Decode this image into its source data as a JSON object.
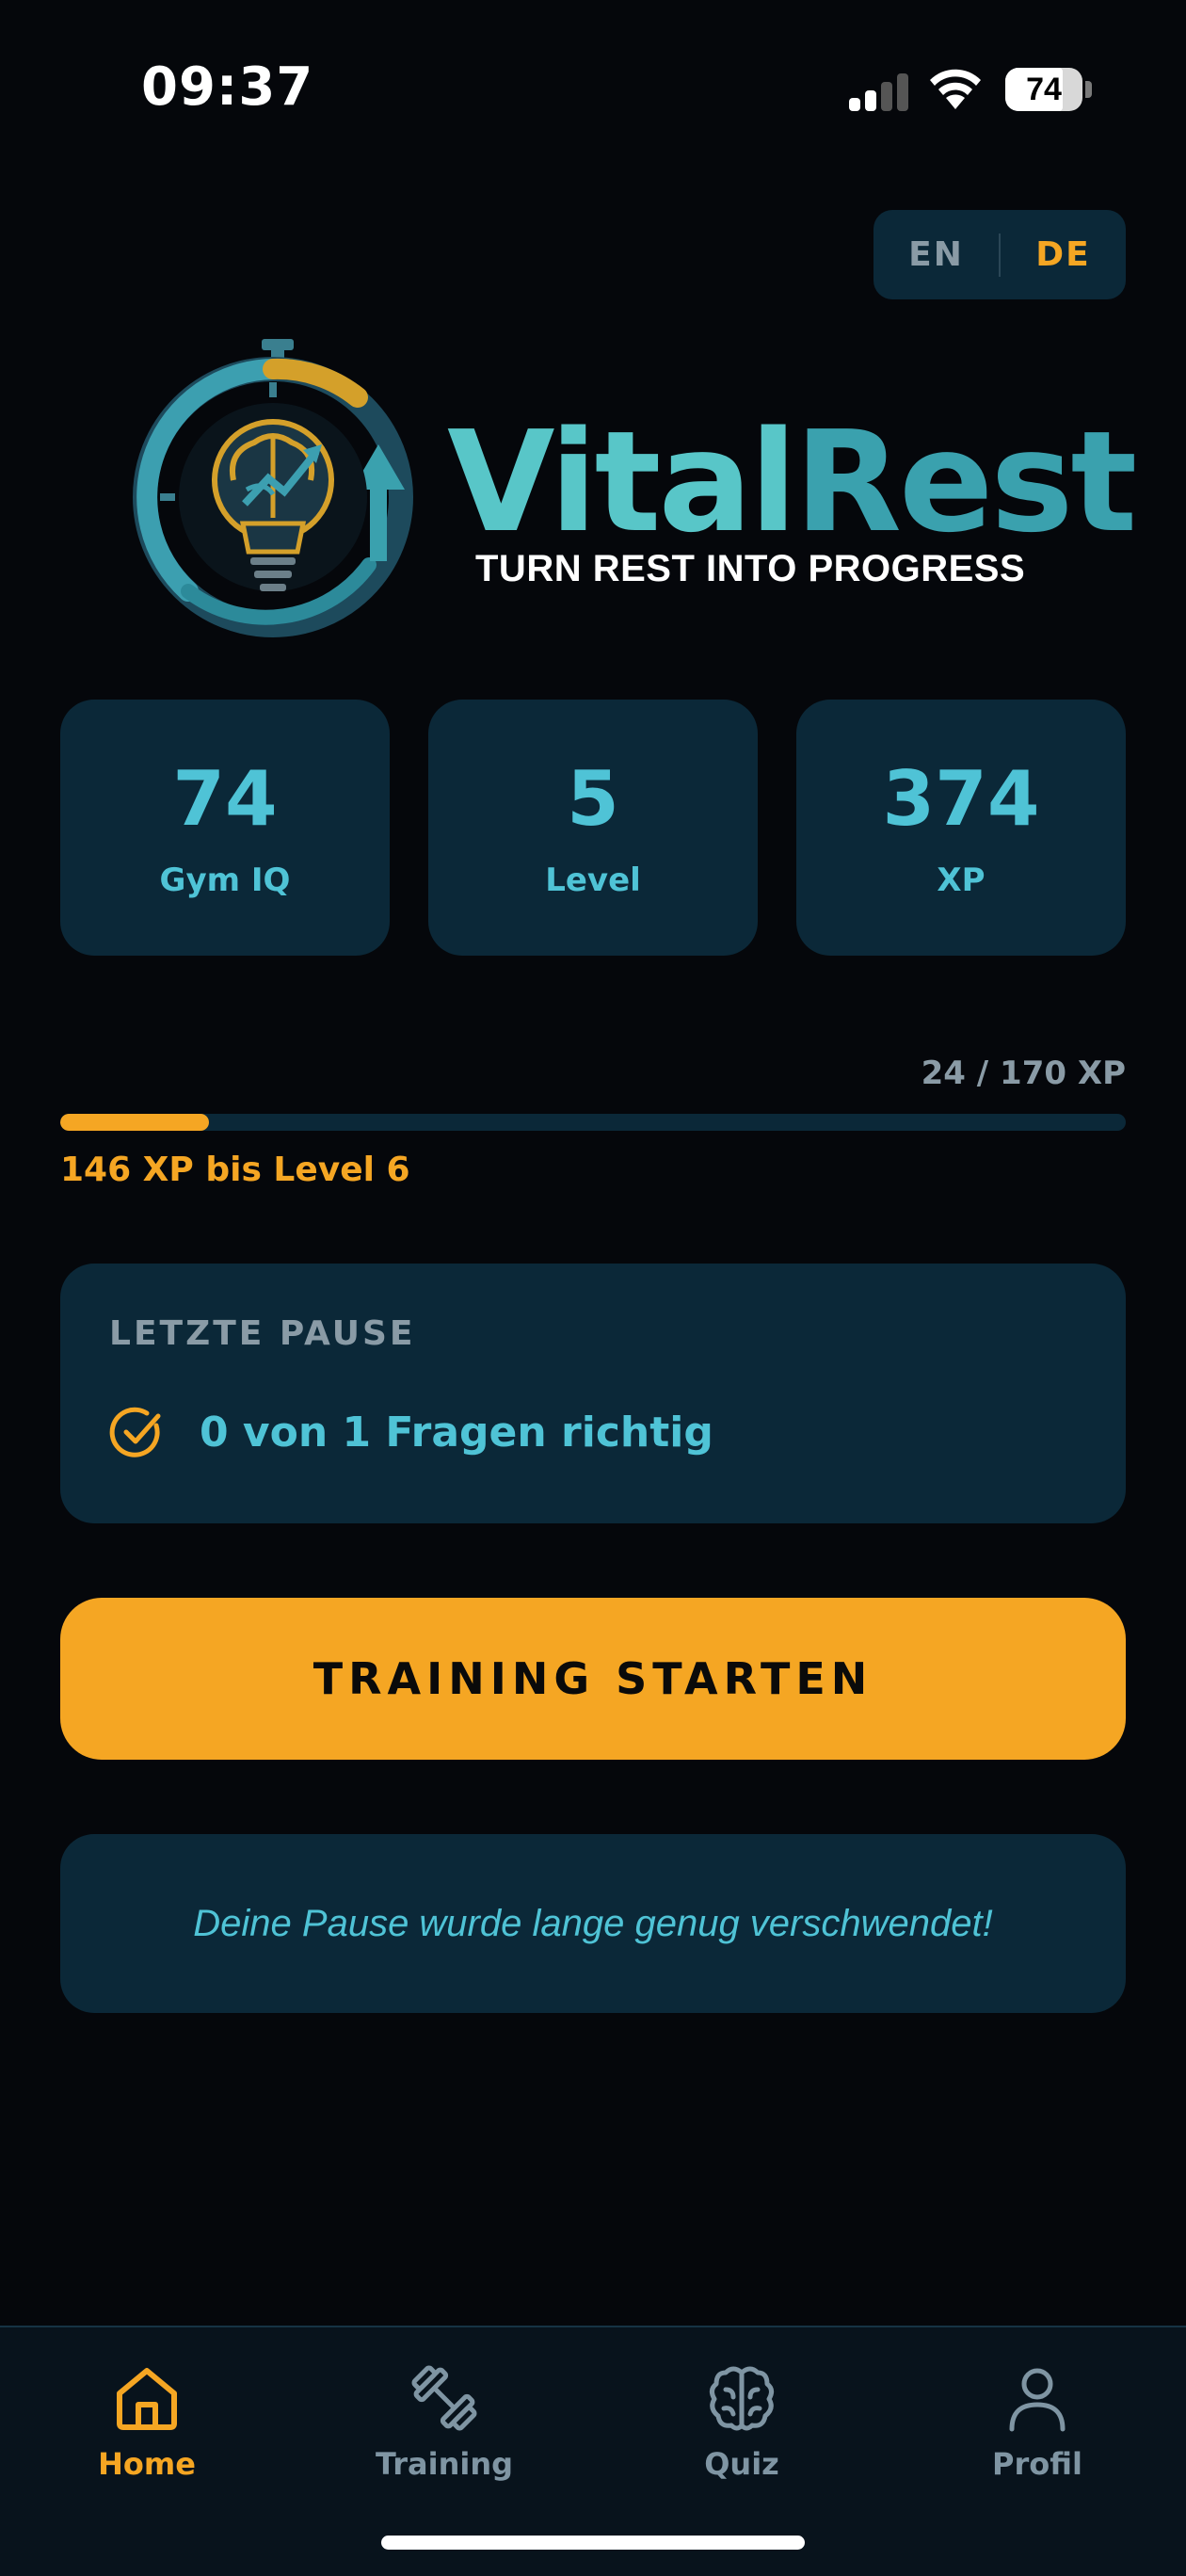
{
  "status_bar": {
    "time": "09:37",
    "battery_level": "74",
    "battery_fraction": 0.74
  },
  "language": {
    "options": [
      "EN",
      "DE"
    ],
    "selected": "DE"
  },
  "brand": {
    "name_part1": "Vital",
    "name_part2": "Rest",
    "tagline": "TURN REST INTO PROGRESS"
  },
  "stats": [
    {
      "value": "74",
      "label": "Gym IQ"
    },
    {
      "value": "5",
      "label": "Level"
    },
    {
      "value": "374",
      "label": "XP"
    }
  ],
  "progress": {
    "counter": "24 / 170 XP",
    "fraction": 0.14,
    "next_level_text": "146 XP bis Level 6"
  },
  "last_pause": {
    "heading": "LETZTE PAUSE",
    "result": "0 von 1 Fragen richtig"
  },
  "start_button": {
    "label": "TRAINING STARTEN"
  },
  "quote": {
    "text": "Deine Pause wurde lange genug verschwendet!"
  },
  "nav": [
    {
      "label": "Home",
      "icon": "home-icon",
      "active": true
    },
    {
      "label": "Training",
      "icon": "dumbbell-icon",
      "active": false
    },
    {
      "label": "Quiz",
      "icon": "brain-icon",
      "active": false
    },
    {
      "label": "Profil",
      "icon": "person-icon",
      "active": false
    }
  ],
  "colors": {
    "accent": "#f5a623",
    "primary": "#4fc3d6",
    "card": "#0b2838",
    "background": "#05070b",
    "muted": "#8a9ba6"
  }
}
